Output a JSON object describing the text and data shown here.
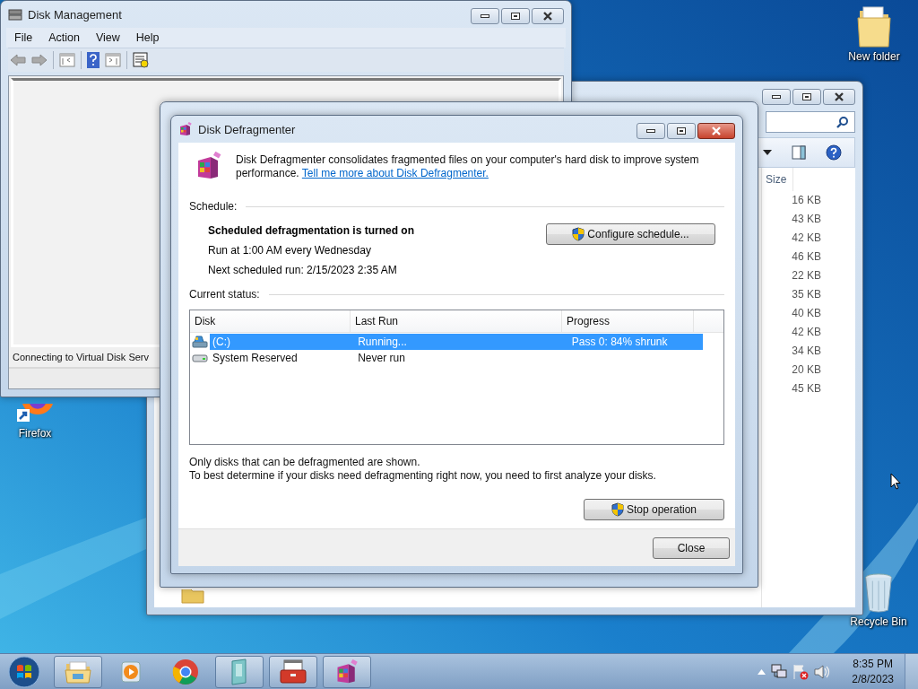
{
  "desktop_icons": [
    {
      "kind": "folder",
      "label": "New folder"
    },
    {
      "kind": "firefox",
      "label": "Firefox"
    },
    {
      "kind": "bin",
      "label": "Recycle Bin"
    }
  ],
  "disk_management": {
    "title": "Disk Management",
    "menu": [
      "File",
      "Action",
      "View",
      "Help"
    ],
    "status": "Connecting to Virtual Disk Serv"
  },
  "explorer": {
    "column": "Size",
    "sizes": [
      "16 KB",
      "43 KB",
      "42 KB",
      "46 KB",
      "22 KB",
      "35 KB",
      "40 KB",
      "42 KB",
      "34 KB",
      "20 KB",
      "45 KB"
    ]
  },
  "dialog": {
    "title": "Disk Defragmenter",
    "intro": "Disk Defragmenter consolidates fragmented files on your computer's hard disk to improve system performance.",
    "link": "Tell me more about Disk Defragmenter.",
    "schedule_label": "Schedule:",
    "schedule_status": "Scheduled defragmentation is turned on",
    "run_at": "Run at 1:00 AM every Wednesday",
    "next_run": "Next scheduled run: 2/15/2023 2:35 AM",
    "configure_button": "Configure schedule...",
    "current_status_label": "Current status:",
    "columns": [
      "Disk",
      "Last Run",
      "Progress"
    ],
    "rows": [
      {
        "kind": "system",
        "disk": "(C:)",
        "last_run": "Running...",
        "progress": "Pass 0: 84% shrunk",
        "selected": true
      },
      {
        "kind": "plain",
        "disk": "System Reserved",
        "last_run": "Never run",
        "selected": false
      }
    ],
    "notes": [
      "Only disks that can be defragmented are shown.",
      "To best determine if your disks need defragmenting right now, you need to first analyze your disks."
    ],
    "stop_button": "Stop operation",
    "close_button": "Close"
  },
  "taskbar": {
    "buttons": [
      {
        "kind": "folder",
        "running": true
      },
      {
        "kind": "media",
        "running": false
      },
      {
        "kind": "chrome",
        "running": false
      },
      {
        "kind": "phone",
        "running": true
      },
      {
        "kind": "toolbox",
        "running": true
      },
      {
        "kind": "defrag",
        "running": true
      }
    ],
    "time": "8:35 PM",
    "date": "2/8/2023"
  }
}
